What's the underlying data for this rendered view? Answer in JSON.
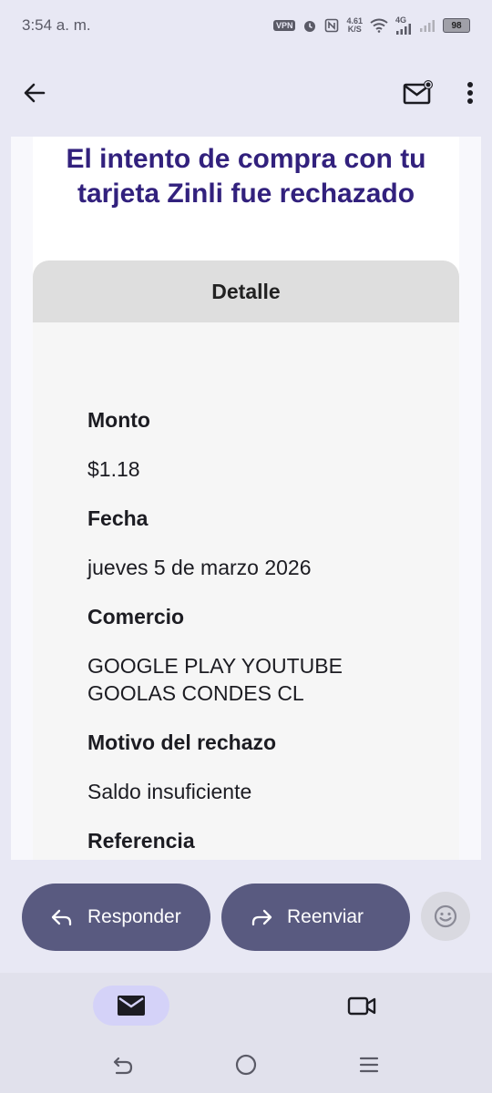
{
  "status_bar": {
    "time": "3:54 a. m.",
    "vpn": "VPN",
    "speed_value": "4.61",
    "speed_unit": "K/S",
    "network": "4G",
    "battery": "98",
    "icons": [
      "vpn-icon",
      "alarm-icon",
      "nfc-icon",
      "wifi-icon",
      "signal-icon",
      "signal-icon",
      "battery-icon"
    ]
  },
  "toolbar": {
    "icons": [
      "back-arrow-icon",
      "mark-unread-icon",
      "more-vert-icon"
    ]
  },
  "email": {
    "title": "El intento de compra con tu tarjeta Zinli fue rechazado",
    "detail_header": "Detalle",
    "fields": [
      {
        "label": "Monto",
        "value": "$1.18"
      },
      {
        "label": "Fecha",
        "value": "jueves 5 de marzo 2026"
      },
      {
        "label": "Comercio",
        "value_line1": "GOOGLE PLAY YOUTUBE",
        "value_line2": "GOOLAS CONDES CL"
      },
      {
        "label": "Motivo del rechazo",
        "value": "Saldo insuficiente"
      },
      {
        "label": "Referencia"
      }
    ]
  },
  "actions": {
    "reply_label": "Responder",
    "forward_label": "Reenviar",
    "icons": [
      "reply-icon",
      "forward-icon",
      "emoji-icon"
    ]
  },
  "bottom_nav": {
    "icons": [
      "mail-icon",
      "video-icon"
    ],
    "active": "mail"
  },
  "system_nav": {
    "icons": [
      "back-gesture-icon",
      "home-icon",
      "recents-icon"
    ]
  },
  "colors": {
    "title": "#32217d",
    "pill": "#595a80",
    "background": "#e8e8f4",
    "nav_active": "#d4d2f8"
  }
}
